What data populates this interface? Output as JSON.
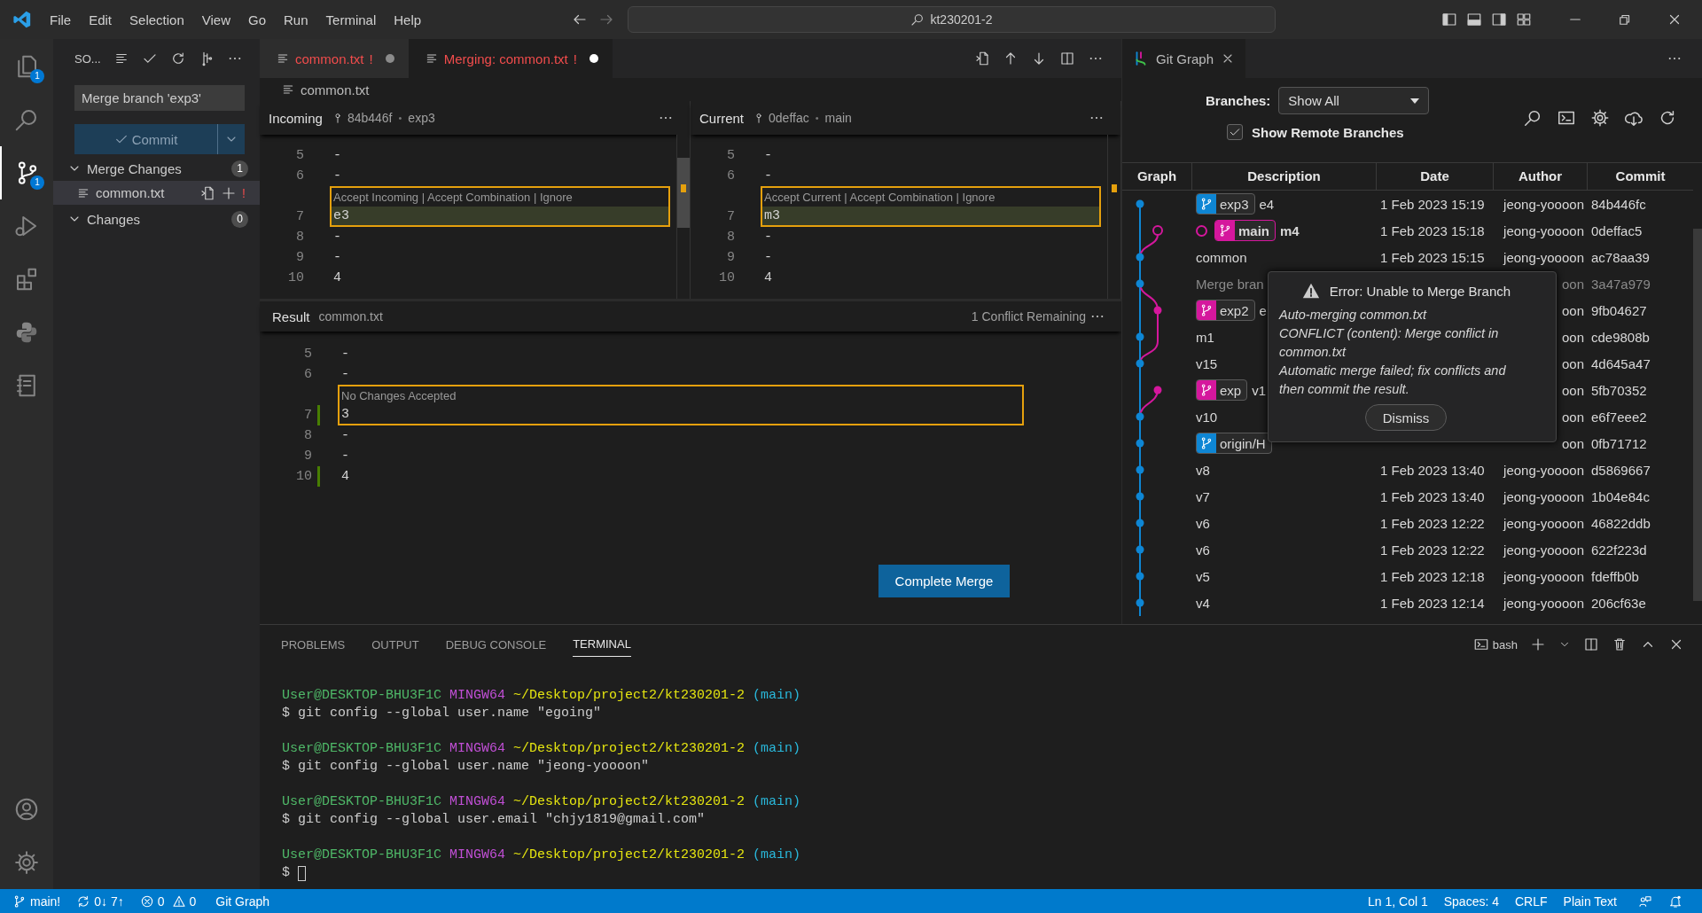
{
  "menu": [
    "File",
    "Edit",
    "Selection",
    "View",
    "Go",
    "Run",
    "Terminal",
    "Help"
  ],
  "command_center": "kt230201-2",
  "activity_bar": [
    {
      "kind": "files",
      "badge": "1",
      "selected": false
    },
    {
      "kind": "search",
      "selected": false
    },
    {
      "kind": "scm",
      "badge": "1",
      "selected": true
    },
    {
      "kind": "debug",
      "selected": false
    },
    {
      "kind": "extensions",
      "selected": false
    },
    {
      "kind": "python",
      "selected": false
    },
    {
      "kind": "notebook",
      "selected": false
    }
  ],
  "sidebar": {
    "title": "SO...",
    "message": "Merge branch 'exp3'",
    "commit": {
      "label": "Commit",
      "disabled": true
    },
    "groups": [
      {
        "label": "Merge Changes",
        "count": "1",
        "expanded": true,
        "files": [
          {
            "name": "common.txt",
            "status": "!",
            "selected": true
          }
        ]
      },
      {
        "label": "Changes",
        "count": "0",
        "expanded": true
      }
    ]
  },
  "editor": {
    "tabs": [
      {
        "label": "common.txt",
        "mark": "!",
        "dirty": true,
        "selected": false
      },
      {
        "label": "Merging: common.txt",
        "mark": "!",
        "dirty": true,
        "selected": true
      }
    ],
    "breadcrumb": "common.txt",
    "panes": [
      {
        "title": "Incoming",
        "commit": "84b446f",
        "separator": "•",
        "branch": "exp3",
        "lines": [
          {
            "kind": "line",
            "n": "5",
            "t": "-"
          },
          {
            "kind": "line",
            "n": "6",
            "t": "-"
          },
          {
            "kind": "conflict",
            "lens": "Accept Incoming | Accept Combination | Ignore",
            "n": "7",
            "t": "e3",
            "highlighted": true
          },
          {
            "kind": "line",
            "n": "8",
            "t": "-"
          },
          {
            "kind": "line",
            "n": "9",
            "t": "-"
          },
          {
            "kind": "line",
            "n": "10",
            "t": "4"
          }
        ]
      },
      {
        "title": "Current",
        "commit": "0deffac",
        "separator": "•",
        "branch": "main",
        "lines": [
          {
            "kind": "line",
            "n": "5",
            "t": "-"
          },
          {
            "kind": "line",
            "n": "6",
            "t": "-"
          },
          {
            "kind": "conflict",
            "lens": "Accept Current | Accept Combination | Ignore",
            "n": "7",
            "t": "m3",
            "highlighted": true
          },
          {
            "kind": "line",
            "n": "8",
            "t": "-"
          },
          {
            "kind": "line",
            "n": "9",
            "t": "-"
          },
          {
            "kind": "line",
            "n": "10",
            "t": "4"
          }
        ]
      }
    ],
    "result": {
      "title": "Result",
      "file": "common.txt",
      "status": "1 Conflict Remaining",
      "button": "Complete Merge",
      "lines": [
        {
          "kind": "line",
          "n": "5",
          "t": "-",
          "changed": false
        },
        {
          "kind": "line",
          "n": "6",
          "t": "-",
          "changed": false
        },
        {
          "kind": "conflict",
          "lens": "No Changes Accepted",
          "n": "7",
          "t": "3",
          "highlighted": false,
          "changed": true
        },
        {
          "kind": "line",
          "n": "8",
          "t": "-",
          "changed": false
        },
        {
          "kind": "line",
          "n": "9",
          "t": "-",
          "changed": false
        },
        {
          "kind": "line",
          "n": "10",
          "t": "4",
          "changed": true
        }
      ]
    }
  },
  "git_graph": {
    "tab": "Git Graph",
    "branches_label": "Branches:",
    "branches_value": "Show All",
    "show_remote": {
      "label": "Show Remote Branches",
      "checked": true
    },
    "columns": [
      "Graph",
      "Description",
      "Date",
      "Author",
      "Commit"
    ],
    "rows": [
      {
        "refs": [
          {
            "name": "exp3",
            "color": "#0e86d4"
          }
        ],
        "desc": "e4",
        "date": "1 Feb 2023 15:19",
        "author": "jeong-yoooon",
        "commit": "84b446fc",
        "head": false,
        "muted": false
      },
      {
        "refs": [
          {
            "name": "main",
            "color": "#d5179d"
          }
        ],
        "desc": "m4",
        "date": "1 Feb 2023 15:18",
        "author": "jeong-yoooon",
        "commit": "0deffac5",
        "head": true,
        "muted": false
      },
      {
        "desc": "common",
        "date": "1 Feb 2023 15:15",
        "author": "jeong-yoooon",
        "commit": "ac78aa39",
        "head": false,
        "muted": false
      },
      {
        "desc": "Merge bran",
        "author": "oon",
        "commit": "3a47a979",
        "head": false,
        "muted": true
      },
      {
        "refs": [
          {
            "name": "exp2",
            "color": "#d5179d"
          }
        ],
        "desc": "e",
        "author": "oon",
        "commit": "9fb04627",
        "head": false,
        "muted": false
      },
      {
        "desc": "m1",
        "author": "oon",
        "commit": "cde9808b",
        "head": false,
        "muted": false
      },
      {
        "desc": "v15",
        "author": "oon",
        "commit": "4d645a47",
        "head": false,
        "muted": false
      },
      {
        "refs": [
          {
            "name": "exp",
            "color": "#d5179d"
          }
        ],
        "desc": "v1",
        "author": "oon",
        "commit": "5fb70352",
        "head": false,
        "muted": false
      },
      {
        "desc": "v10",
        "author": "oon",
        "commit": "e6f7eee2",
        "head": false,
        "muted": false
      },
      {
        "refs": [
          {
            "name": "origin/H",
            "color": "#0e86d4"
          }
        ],
        "author": "oon",
        "commit": "0fb71712",
        "head": false,
        "muted": false
      },
      {
        "desc": "v8",
        "date": "1 Feb 2023 13:40",
        "author": "jeong-yoooon",
        "commit": "d5869667",
        "head": false,
        "muted": false
      },
      {
        "desc": "v7",
        "date": "1 Feb 2023 13:40",
        "author": "jeong-yoooon",
        "commit": "1b04e84c",
        "head": false,
        "muted": false
      },
      {
        "desc": "v6",
        "date": "1 Feb 2023 12:22",
        "author": "jeong-yoooon",
        "commit": "46822ddb",
        "head": false,
        "muted": false
      },
      {
        "desc": "v6",
        "date": "1 Feb 2023 12:22",
        "author": "jeong-yoooon",
        "commit": "622f223d",
        "head": false,
        "muted": false
      },
      {
        "desc": "v5",
        "date": "1 Feb 2023 12:18",
        "author": "jeong-yoooon",
        "commit": "fdeffb0b",
        "head": false,
        "muted": false
      },
      {
        "desc": "v4",
        "date": "1 Feb 2023 12:14",
        "author": "jeong-yoooon",
        "commit": "206cf63e",
        "head": false,
        "muted": false
      }
    ],
    "dialog": {
      "title": "Error: Unable to Merge Branch",
      "message": [
        "Auto-merging common.txt",
        "CONFLICT (content): Merge conflict in common.txt",
        "Automatic merge failed; fix conflicts and then commit the result."
      ],
      "button": "Dismiss"
    }
  },
  "panel": {
    "tabs": [
      {
        "label": "PROBLEMS",
        "selected": false
      },
      {
        "label": "OUTPUT",
        "selected": false
      },
      {
        "label": "DEBUG CONSOLE",
        "selected": false
      },
      {
        "label": "TERMINAL",
        "selected": true
      }
    ],
    "shell": "bash",
    "terminal": [
      {
        "prompt": [
          {
            "text": "User@DESKTOP-BHU3F1C",
            "color": "#4fb868"
          },
          {
            "text": "MINGW64",
            "color": "#c14fd6"
          },
          {
            "text": "~/Desktop/project2/kt230201-2",
            "color": "#e5e510"
          },
          {
            "text": "(main)",
            "color": "#29b8db"
          }
        ],
        "command": "$ git config --global user.name \"egoing\"",
        "cursor": false
      },
      {
        "prompt": [
          {
            "text": "User@DESKTOP-BHU3F1C",
            "color": "#4fb868"
          },
          {
            "text": "MINGW64",
            "color": "#c14fd6"
          },
          {
            "text": "~/Desktop/project2/kt230201-2",
            "color": "#e5e510"
          },
          {
            "text": "(main)",
            "color": "#29b8db"
          }
        ],
        "command": "$ git config --global user.name \"jeong-yoooon\"",
        "cursor": false
      },
      {
        "prompt": [
          {
            "text": "User@DESKTOP-BHU3F1C",
            "color": "#4fb868"
          },
          {
            "text": "MINGW64",
            "color": "#c14fd6"
          },
          {
            "text": "~/Desktop/project2/kt230201-2",
            "color": "#e5e510"
          },
          {
            "text": "(main)",
            "color": "#29b8db"
          }
        ],
        "command": "$ git config --global user.email \"chjy1819@gmail.com\"",
        "cursor": false
      },
      {
        "prompt": [
          {
            "text": "User@DESKTOP-BHU3F1C",
            "color": "#4fb868"
          },
          {
            "text": "MINGW64",
            "color": "#c14fd6"
          },
          {
            "text": "~/Desktop/project2/kt230201-2",
            "color": "#e5e510"
          },
          {
            "text": "(main)",
            "color": "#29b8db"
          }
        ],
        "command": "$",
        "cursor": true
      }
    ]
  },
  "status_bar": {
    "left": [
      {
        "kind": "branch",
        "text": "main!"
      },
      {
        "kind": "sync",
        "text": "0↓ 7↑"
      },
      {
        "kind": "problems",
        "errors": "0",
        "warnings": "0"
      },
      {
        "kind": "text",
        "text": "Git Graph"
      }
    ],
    "right": [
      "Ln 1, Col 1",
      "Spaces: 4",
      "CRLF",
      "Plain Text"
    ]
  }
}
